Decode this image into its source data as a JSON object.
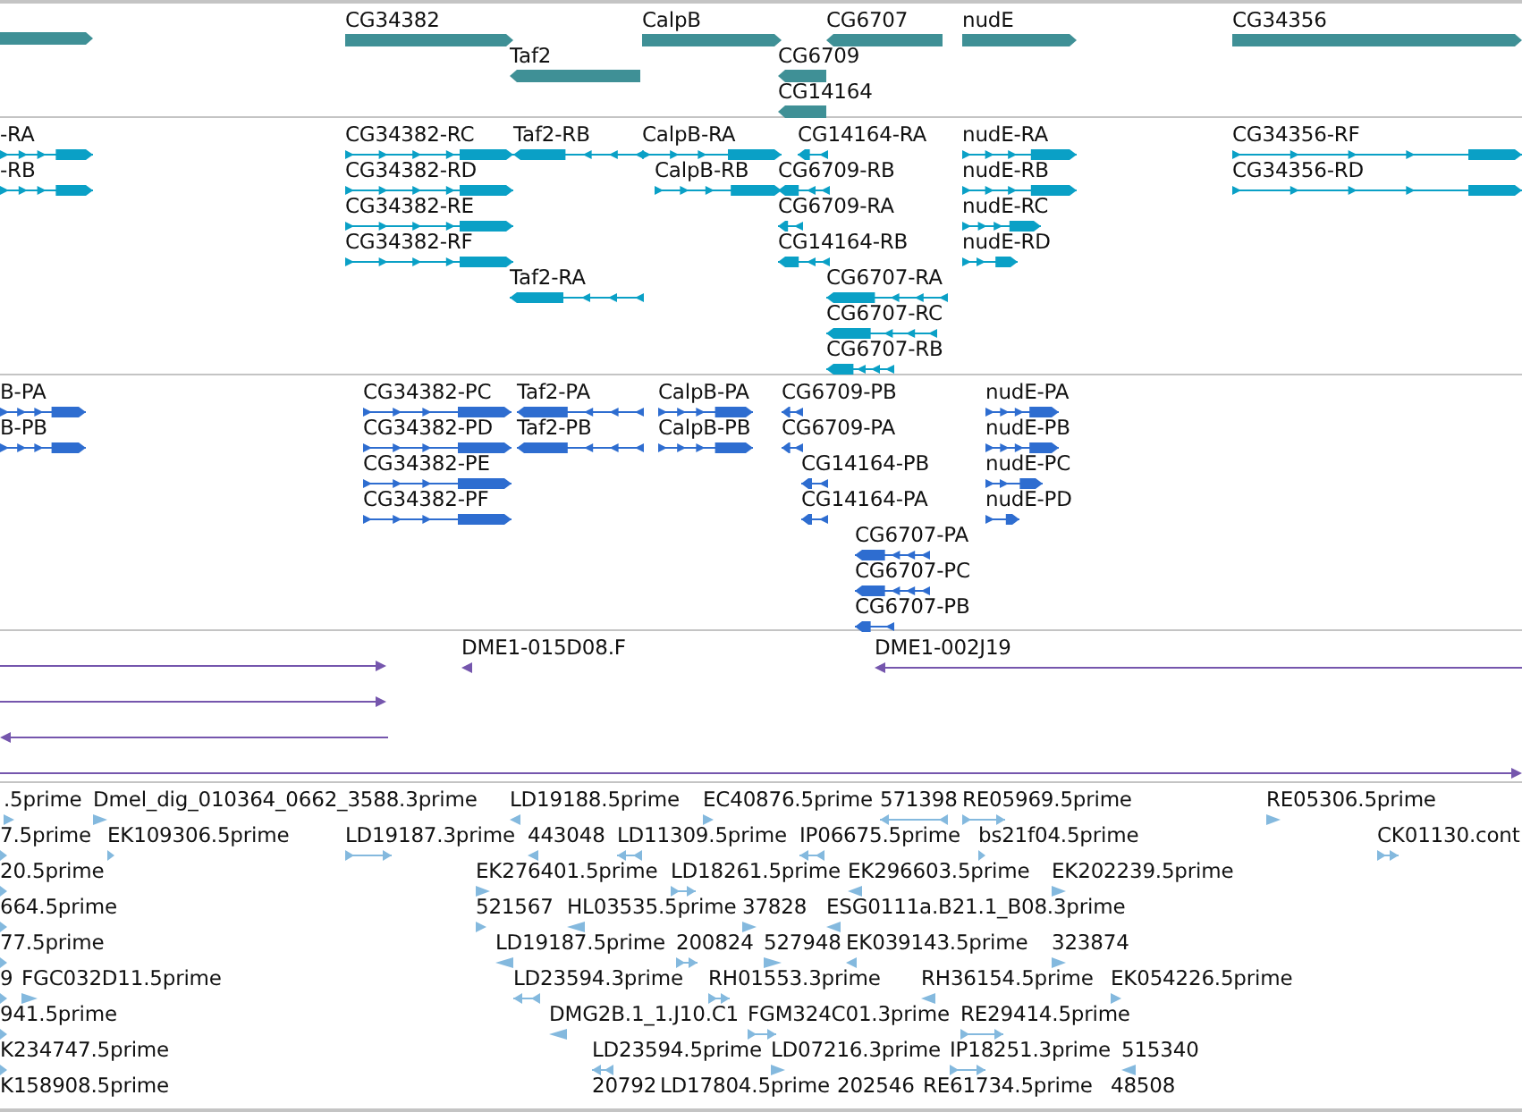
{
  "tracks": [
    {
      "kind": "gene",
      "features": [
        {
          "reverse": false
        },
        {
          "label": "CG34382",
          "reverse": false
        },
        {
          "label": "Taf2",
          "reverse": true
        },
        {
          "label": "CalpB",
          "reverse": false
        },
        {
          "label": "CG6707",
          "reverse": true
        },
        {
          "label": "CG6709",
          "reverse": true
        },
        {
          "label": "CG14164",
          "reverse": true
        },
        {
          "label": "nudE",
          "reverse": false
        },
        {
          "label": "CG34356",
          "reverse": false
        }
      ]
    },
    {
      "kind": "transcript",
      "features": [
        {
          "label": "-RA",
          "reverse": false
        },
        {
          "label": "-RB",
          "reverse": false
        },
        {
          "label": "CG34382-RC",
          "reverse": false
        },
        {
          "label": "CG34382-RD",
          "reverse": false
        },
        {
          "label": "CG34382-RE",
          "reverse": false
        },
        {
          "label": "CG34382-RF",
          "reverse": false
        },
        {
          "label": "Taf2-RB",
          "reverse": true
        },
        {
          "label": "Taf2-RA",
          "reverse": true
        },
        {
          "label": "CalpB-RA",
          "reverse": false
        },
        {
          "label": "CalpB-RB",
          "reverse": false
        },
        {
          "label": "CG14164-RA",
          "reverse": true
        },
        {
          "label": "CG6709-RB",
          "reverse": true
        },
        {
          "label": "CG6709-RA",
          "reverse": true
        },
        {
          "label": "CG14164-RB",
          "reverse": true
        },
        {
          "label": "CG6707-RA",
          "reverse": true
        },
        {
          "label": "CG6707-RC",
          "reverse": true
        },
        {
          "label": "CG6707-RB",
          "reverse": true
        },
        {
          "label": "nudE-RA",
          "reverse": false
        },
        {
          "label": "nudE-RB",
          "reverse": false
        },
        {
          "label": "nudE-RC",
          "reverse": false
        },
        {
          "label": "nudE-RD",
          "reverse": false
        },
        {
          "label": "CG34356-RF",
          "reverse": false
        },
        {
          "label": "CG34356-RD",
          "reverse": false
        }
      ]
    },
    {
      "kind": "protein",
      "features": [
        {
          "label": "B-PA",
          "reverse": false
        },
        {
          "label": "B-PB",
          "reverse": false
        },
        {
          "label": "CG34382-PC",
          "reverse": false
        },
        {
          "label": "CG34382-PD",
          "reverse": false
        },
        {
          "label": "CG34382-PE",
          "reverse": false
        },
        {
          "label": "CG34382-PF",
          "reverse": false
        },
        {
          "label": "Taf2-PA",
          "reverse": true
        },
        {
          "label": "Taf2-PB",
          "reverse": true
        },
        {
          "label": "CalpB-PA",
          "reverse": false
        },
        {
          "label": "CalpB-PB",
          "reverse": false
        },
        {
          "label": "CG6709-PB",
          "reverse": true
        },
        {
          "label": "CG6709-PA",
          "reverse": true
        },
        {
          "label": "CG14164-PB",
          "reverse": true
        },
        {
          "label": "CG14164-PA",
          "reverse": true
        },
        {
          "label": "CG6707-PA",
          "reverse": true
        },
        {
          "label": "CG6707-PC",
          "reverse": true
        },
        {
          "label": "CG6707-PB",
          "reverse": true
        },
        {
          "label": "nudE-PA",
          "reverse": false
        },
        {
          "label": "nudE-PB",
          "reverse": false
        },
        {
          "label": "nudE-PC",
          "reverse": false
        },
        {
          "label": "nudE-PD",
          "reverse": false
        }
      ]
    },
    {
      "kind": "clone",
      "features": [
        {
          "reverse": false
        },
        {
          "label": "DME1-015D08.F",
          "reverse": true
        },
        {
          "label": "DME1-002J19",
          "reverse": true
        },
        {
          "reverse": false
        },
        {
          "reverse": true
        },
        {
          "reverse": false
        }
      ]
    },
    {
      "kind": "est",
      "features": [
        {
          "label": ".5prime",
          "reverse": false
        },
        {
          "label": "Dmel_dig_010364_0662_3588.3prime",
          "reverse": false
        },
        {
          "label": "LD19188.5prime",
          "reverse": true
        },
        {
          "label": "EC40876.5prime",
          "reverse": false
        },
        {
          "label": "571398",
          "reverse": true
        },
        {
          "label": "RE05969.5prime",
          "reverse": false
        },
        {
          "label": "RE05306.5prime",
          "reverse": false
        },
        {
          "label": "7.5prime",
          "reverse": false
        },
        {
          "label": "EK109306.5prime",
          "reverse": false
        },
        {
          "label": "LD19187.3prime",
          "reverse": false
        },
        {
          "label": "443048",
          "reverse": true
        },
        {
          "label": "LD11309.5prime",
          "reverse": true
        },
        {
          "label": "IP06675.5prime",
          "reverse": true
        },
        {
          "label": "bs21f04.5prime",
          "reverse": false
        },
        {
          "label": "CK01130.cont",
          "reverse": false
        },
        {
          "label": "20.5prime",
          "reverse": false
        },
        {
          "label": "EK276401.5prime",
          "reverse": false
        },
        {
          "label": "LD18261.5prime",
          "reverse": false
        },
        {
          "label": "EK296603.5prime",
          "reverse": true
        },
        {
          "label": "EK202239.5prime",
          "reverse": false
        },
        {
          "label": "664.5prime",
          "reverse": false
        },
        {
          "label": "521567",
          "reverse": false
        },
        {
          "label": "HL03535.5prime",
          "reverse": true
        },
        {
          "label": "37828",
          "reverse": false
        },
        {
          "label": "ESG0111a.B21.1_B08.3prime",
          "reverse": true
        },
        {
          "label": "77.5prime",
          "reverse": false
        },
        {
          "label": "LD19187.5prime",
          "reverse": true
        },
        {
          "label": "200824",
          "reverse": false
        },
        {
          "label": "527948",
          "reverse": false
        },
        {
          "label": "EK039143.5prime",
          "reverse": true
        },
        {
          "label": "323874",
          "reverse": false
        },
        {
          "label": "9",
          "reverse": false
        },
        {
          "label": "FGC032D11.5prime",
          "reverse": false
        },
        {
          "label": "LD23594.3prime",
          "reverse": true
        },
        {
          "label": "RH01553.3prime",
          "reverse": false
        },
        {
          "label": "RH36154.5prime",
          "reverse": true
        },
        {
          "label": "EK054226.5prime",
          "reverse": false
        },
        {
          "label": "941.5prime",
          "reverse": false
        },
        {
          "label": "DMG2B.1_1.J10.C1",
          "reverse": true
        },
        {
          "label": "FGM324C01.3prime",
          "reverse": false
        },
        {
          "label": "RE29414.5prime",
          "reverse": false
        },
        {
          "label": "K234747.5prime",
          "reverse": false
        },
        {
          "label": "LD23594.5prime",
          "reverse": true
        },
        {
          "label": "LD07216.3prime",
          "reverse": false
        },
        {
          "label": "IP18251.3prime",
          "reverse": false
        },
        {
          "label": "515340",
          "reverse": true
        },
        {
          "label": "K158908.5prime"
        },
        {
          "label": "20792"
        },
        {
          "label": "LD17804.5prime"
        },
        {
          "label": "202546"
        },
        {
          "label": "RE61734.5prime"
        },
        {
          "label": "48508"
        }
      ]
    }
  ]
}
